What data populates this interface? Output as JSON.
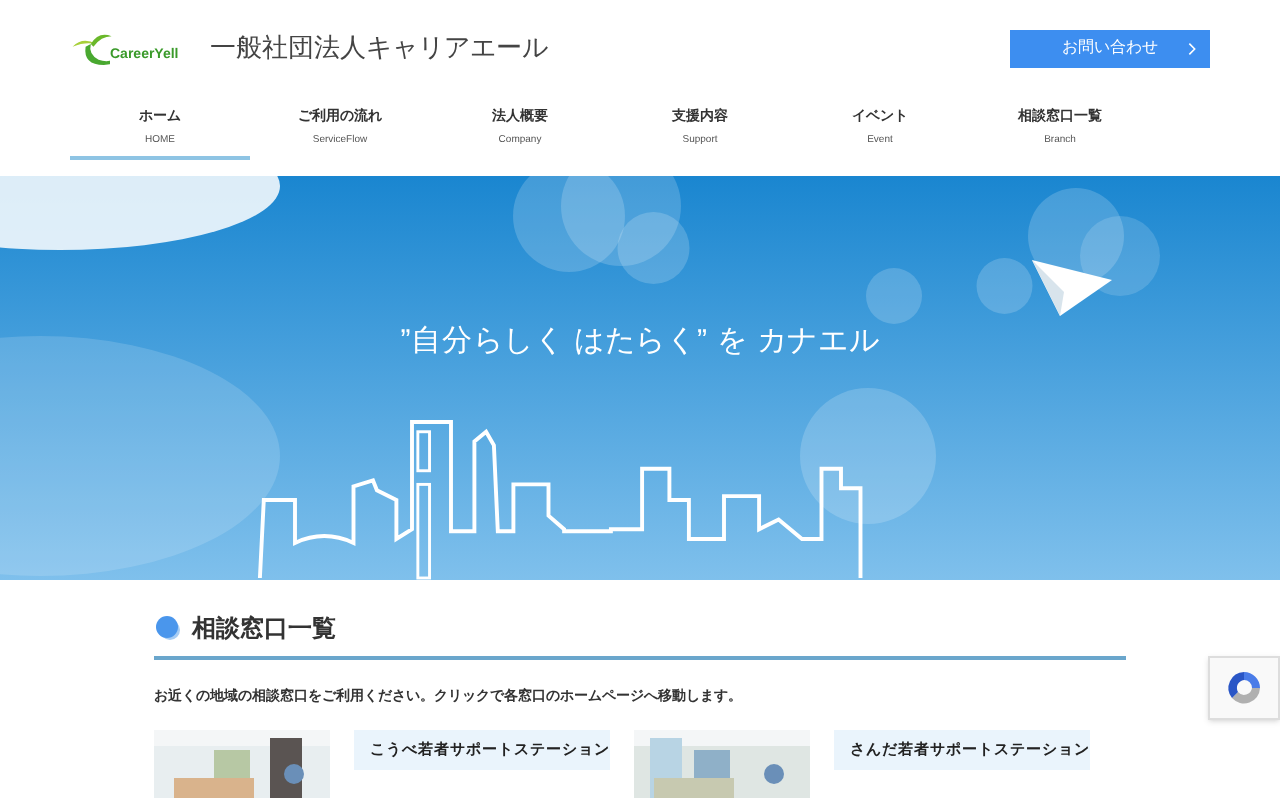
{
  "header": {
    "logo_text": "CareerYell",
    "site_title": "一般社団法人キャリアエール",
    "contact_button": "お問い合わせ"
  },
  "nav": [
    {
      "label": "ホーム",
      "sub": "HOME",
      "selected": true
    },
    {
      "label": "ご利用の流れ",
      "sub": "ServiceFlow",
      "selected": false
    },
    {
      "label": "法人概要",
      "sub": "Company",
      "selected": false
    },
    {
      "label": "支援内容",
      "sub": "Support",
      "selected": false
    },
    {
      "label": "イベント",
      "sub": "Event",
      "selected": false
    },
    {
      "label": "相談窓口一覧",
      "sub": "Branch",
      "selected": false
    }
  ],
  "hero": {
    "kind": "picture",
    "tagline": "”自分らしく はたらく” を カナエル"
  },
  "section": {
    "title": "相談窓口一覧",
    "description": "お近くの地域の相談窓口をご利用ください。クリックで各窓口のホームページへ移動します。"
  },
  "offices": [
    {
      "kind": "picture",
      "name": "こうべ若者サポートステーション"
    },
    {
      "kind": "picture",
      "name": "さんだ若者サポートステーション"
    }
  ]
}
